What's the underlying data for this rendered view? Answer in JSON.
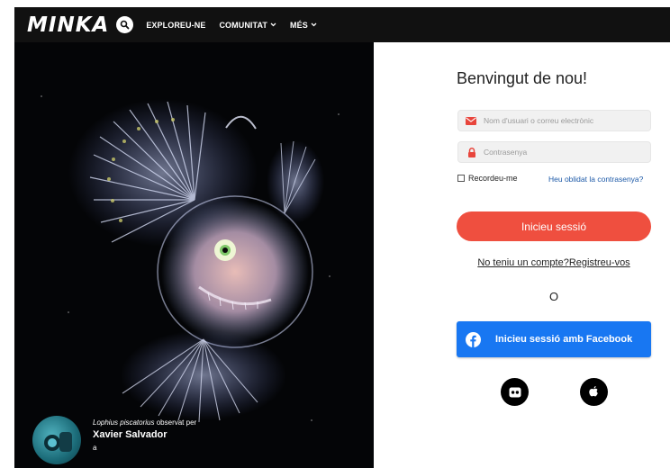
{
  "header": {
    "logo": "MINKA",
    "nav": [
      {
        "label": "EXPLOREU-NE",
        "has_dropdown": false
      },
      {
        "label": "COMUNITAT",
        "has_dropdown": true
      },
      {
        "label": "MÉS",
        "has_dropdown": true
      }
    ]
  },
  "photo": {
    "species": "Lophius piscatorius",
    "observed_by": "observat per",
    "observer": "Xavier Salvador",
    "sub": "a"
  },
  "login": {
    "title": "Benvingut de nou!",
    "username_placeholder": "Nom d'usuari o correu electrònic",
    "password_placeholder": "Contrasenya",
    "remember_label": "Recordeu-me",
    "forgot_link": "Heu oblidat la contrasenya?",
    "login_button": "Inicieu sessió",
    "no_account": "No teniu un compte?",
    "register_link": "Registreu-vos",
    "or_label": "O",
    "facebook_button": "Inicieu sessió amb Facebook"
  },
  "colors": {
    "accent_red": "#ef4f3f",
    "facebook_blue": "#1877f2",
    "link_blue": "#1e5aa8",
    "topbar": "#111111"
  },
  "icons": [
    "search-icon",
    "envelope-icon",
    "lock-icon",
    "facebook-icon",
    "flickr-icon",
    "apple-icon"
  ]
}
